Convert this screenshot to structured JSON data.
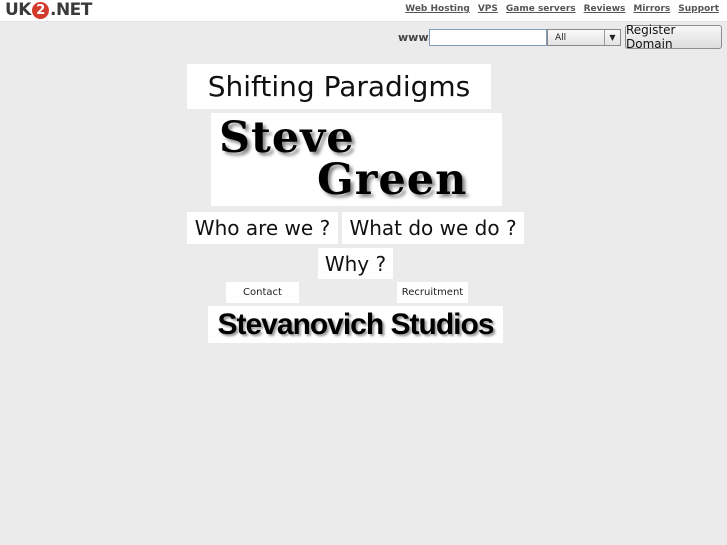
{
  "header": {
    "logo": {
      "prefix": "UK",
      "two": "2",
      "suffix": ".NET"
    },
    "nav": [
      "Web Hosting",
      "VPS",
      "Game servers",
      "Reviews",
      "Mirrors",
      "Support"
    ]
  },
  "domain_search": {
    "prefix": "www.",
    "input_value": "",
    "tld_selected": "All",
    "register_label": "Register Domain"
  },
  "content": {
    "title": "Shifting Paradigms",
    "name_first": "Steve",
    "name_last": "Green",
    "who_label": "Who are we ?",
    "what_label": "What do we do ?",
    "why_label": "Why ?",
    "contact_label": "Contact",
    "recruitment_label": "Recruitment",
    "studios_label": "Stevanovich Studios"
  },
  "colors": {
    "page_bg": "#ebebeb",
    "logo_accent": "#d23a2b",
    "panel_bg": "#ffffff"
  }
}
